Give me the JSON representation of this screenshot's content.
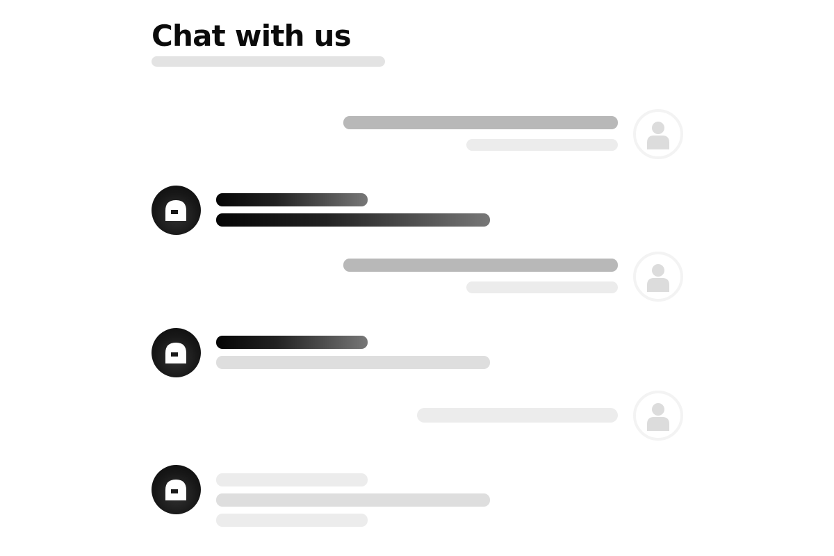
{
  "header": {
    "title": "Chat with us"
  },
  "icons": {
    "user_avatar": "person-placeholder-icon",
    "agent_avatar": "brand-logo-a-icon"
  },
  "colors": {
    "title_text": "#0b0b0b",
    "placeholder_gray": "#b8b8b8",
    "placeholder_light": "#ececec",
    "agent_avatar_bg": "#141414",
    "agent_logo": "#ffffff"
  }
}
